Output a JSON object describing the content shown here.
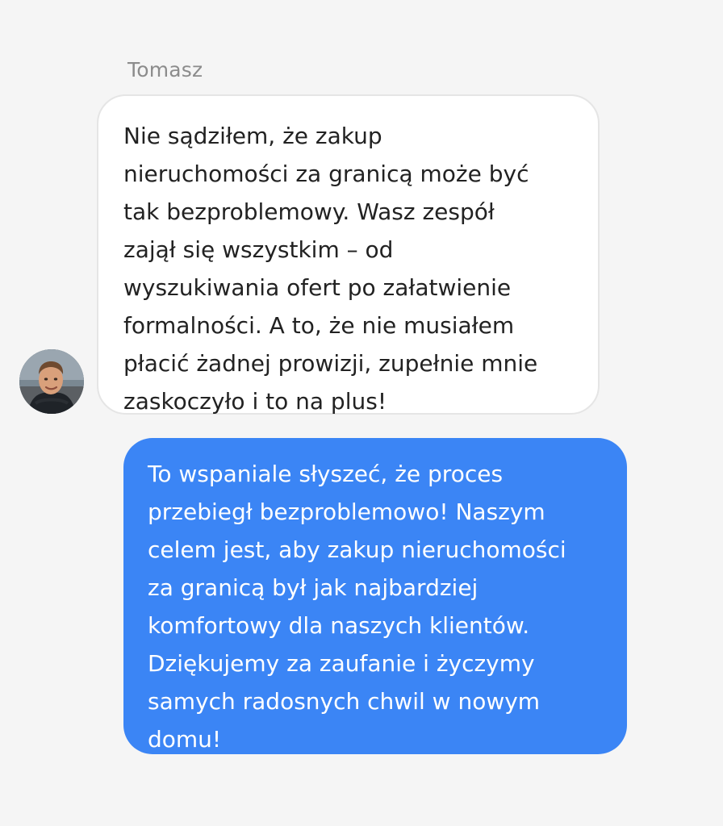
{
  "conversation": {
    "incoming": {
      "sender_name": "Tomasz",
      "avatar_icon": "person-photo-avatar",
      "text": "Nie sądziłem, że zakup\nnieruchomości za granicą może być\ntak bezproblemowy. Wasz zespół\nzajął się wszystkim – od\nwyszukiwania ofert po załatwienie\nformalności. A to, że nie musiałem\npłacić żadnej prowizji, zupełnie mnie\nzaskoczyło i to na plus!"
    },
    "outgoing": {
      "text": "To wspaniale słyszeć, że proces\nprzebiegł bezproblemowo! Naszym\ncelem jest, aby zakup nieruchomości\nza granicą był jak najbardziej\nkomfortowy dla naszych klientów.\nDziękujemy za zaufanie i życzymy\nsamych radosnych chwil w nowym\ndomu!"
    }
  },
  "colors": {
    "background": "#f5f5f5",
    "incoming_bubble": "#ffffff",
    "incoming_border": "#e5e5e5",
    "outgoing_bubble": "#3b85f5",
    "sender_name": "#8c8c8c"
  }
}
